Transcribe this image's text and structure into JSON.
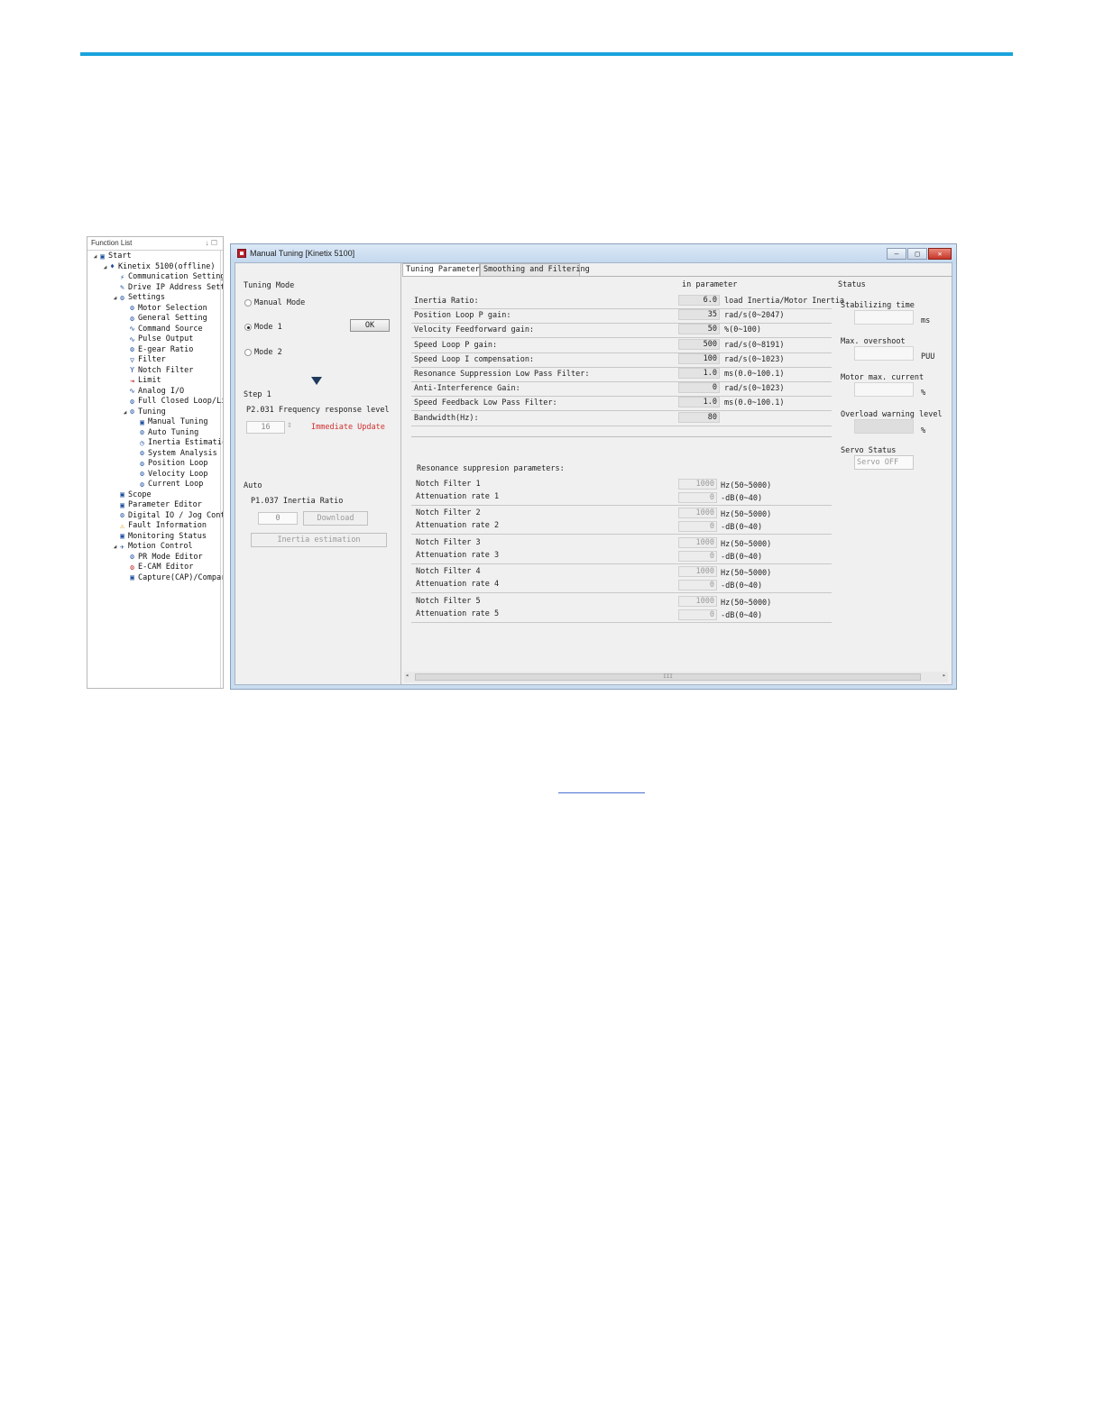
{
  "function_list": {
    "title": "Function List",
    "pin": "↓ ☐",
    "items": [
      {
        "label": "Start",
        "icon": "start-icon"
      },
      {
        "label": "Kinetix 5100(offline)",
        "icon": "drive-icon"
      },
      {
        "label": "Communication Setting",
        "icon": "communication-icon"
      },
      {
        "label": "Drive IP Address Setti",
        "icon": "wrench-icon"
      },
      {
        "label": "Settings",
        "icon": "settings-icon"
      },
      {
        "label": "Motor Selection",
        "icon": "motor-icon"
      },
      {
        "label": "General Setting",
        "icon": "gear-icon"
      },
      {
        "label": "Command Source",
        "icon": "command-icon"
      },
      {
        "label": "Pulse Output",
        "icon": "pulse-icon"
      },
      {
        "label": "E-gear Ratio",
        "icon": "gear-ratio-icon"
      },
      {
        "label": "Filter",
        "icon": "filter-icon"
      },
      {
        "label": "Notch Filter",
        "icon": "notch-filter-icon"
      },
      {
        "label": "Limit",
        "icon": "limit-icon"
      },
      {
        "label": "Analog I/O",
        "icon": "analog-icon"
      },
      {
        "label": "Full Closed Loop/Li",
        "icon": "loop-icon"
      },
      {
        "label": "Tuning",
        "icon": "tuning-icon"
      },
      {
        "label": "Manual Tuning",
        "icon": "manual-tuning-icon"
      },
      {
        "label": "Auto Tuning",
        "icon": "auto-tuning-icon"
      },
      {
        "label": "Inertia Estimatic",
        "icon": "inertia-icon"
      },
      {
        "label": "System Analysis",
        "icon": "analysis-icon"
      },
      {
        "label": "Position Loop",
        "icon": "position-loop-icon"
      },
      {
        "label": "Velocity Loop",
        "icon": "velocity-loop-icon"
      },
      {
        "label": "Current Loop",
        "icon": "current-loop-icon"
      },
      {
        "label": "Scope",
        "icon": "scope-icon"
      },
      {
        "label": "Parameter Editor",
        "icon": "parameter-icon"
      },
      {
        "label": "Digital IO / Jog Contr",
        "icon": "digital-io-icon"
      },
      {
        "label": "Fault Information",
        "icon": "warning-icon"
      },
      {
        "label": "Monitoring Status",
        "icon": "monitor-icon"
      },
      {
        "label": "Motion Control",
        "icon": "motion-icon"
      },
      {
        "label": "PR Mode Editor",
        "icon": "pr-mode-icon"
      },
      {
        "label": "E-CAM Editor",
        "icon": "ecam-icon"
      },
      {
        "label": "Capture(CAP)/Compar",
        "icon": "capture-icon"
      }
    ]
  },
  "window": {
    "title": "Manual Tuning [Kinetix 5100]",
    "min": "—",
    "max": "□",
    "close": "✕"
  },
  "left": {
    "tuning_mode": "Tuning Mode",
    "manual_mode": "Manual Mode",
    "mode1": "Mode 1",
    "mode2": "Mode 2",
    "ok": "OK",
    "step1": "Step 1",
    "freq_label": "P2.031 Frequency response level",
    "freq_value": "16",
    "immediate": "Immediate Update",
    "auto": "Auto",
    "inertia_label": "P1.037 Inertia Ratio",
    "inertia_value": "0",
    "download": "Download",
    "inertia_est": "Inertia estimation"
  },
  "tabs": {
    "tab1": "Tuning Parameters",
    "tab2": "Smoothing and Filtering"
  },
  "params": {
    "header": "in parameter",
    "rows": [
      {
        "label": "Inertia Ratio:",
        "value": "6.0",
        "unit": "load Inertia/Motor Inertia"
      },
      {
        "label": "Position Loop P gain:",
        "value": "35",
        "unit": "rad/s(0~2047)"
      },
      {
        "label": "Velocity Feedforward gain:",
        "value": "50",
        "unit": "%(0~100)"
      },
      {
        "label": "Speed Loop P gain:",
        "value": "500",
        "unit": "rad/s(0~8191)"
      },
      {
        "label": "Speed Loop I compensation:",
        "value": "100",
        "unit": "rad/s(0~1023)"
      },
      {
        "label": "Resonance Suppression Low Pass Filter:",
        "value": "1.0",
        "unit": "ms(0.0~100.1)"
      },
      {
        "label": "Anti-Interference Gain:",
        "value": "0",
        "unit": "rad/s(0~1023)"
      },
      {
        "label": "Speed Feedback Low Pass Filter:",
        "value": "1.0",
        "unit": "ms(0.0~100.1)"
      },
      {
        "label": "Bandwidth(Hz):",
        "value": "80",
        "unit": ""
      }
    ],
    "resonance_title": "Resonance suppresion parameters:",
    "notch": [
      {
        "label": "Notch Filter 1",
        "freq": "1000",
        "freq_unit": "Hz(50~5000)",
        "att_label": "Attenuation rate 1",
        "att": "0",
        "att_unit": "-dB(0~40)"
      },
      {
        "label": "Notch Filter 2",
        "freq": "1000",
        "freq_unit": "Hz(50~5000)",
        "att_label": "Attenuation rate 2",
        "att": "0",
        "att_unit": "-dB(0~40)"
      },
      {
        "label": "Notch Filter 3",
        "freq": "1000",
        "freq_unit": "Hz(50~5000)",
        "att_label": "Attenuation rate 3",
        "att": "0",
        "att_unit": "-dB(0~40)"
      },
      {
        "label": "Notch Filter 4",
        "freq": "1000",
        "freq_unit": "Hz(50~5000)",
        "att_label": "Attenuation rate 4",
        "att": "0",
        "att_unit": "-dB(0~40)"
      },
      {
        "label": "Notch Filter 5",
        "freq": "1000",
        "freq_unit": "Hz(50~5000)",
        "att_label": "Attenuation rate 5",
        "att": "0",
        "att_unit": "-dB(0~40)"
      }
    ]
  },
  "status": {
    "title": "Status",
    "stabilizing": "Stabilizing time",
    "stabilizing_unit": "ms",
    "overshoot": "Max. overshoot",
    "overshoot_unit": "PUU",
    "current": "Motor max. current",
    "current_unit": "%",
    "overload": "Overload warning level",
    "overload_unit": "%",
    "servo": "Servo Status",
    "servo_value": "Servo OFF"
  },
  "scroll": {
    "thumb": "III"
  },
  "colors": {
    "accent_bar": "#1aa3dc",
    "immediate_update": "#d23030"
  }
}
